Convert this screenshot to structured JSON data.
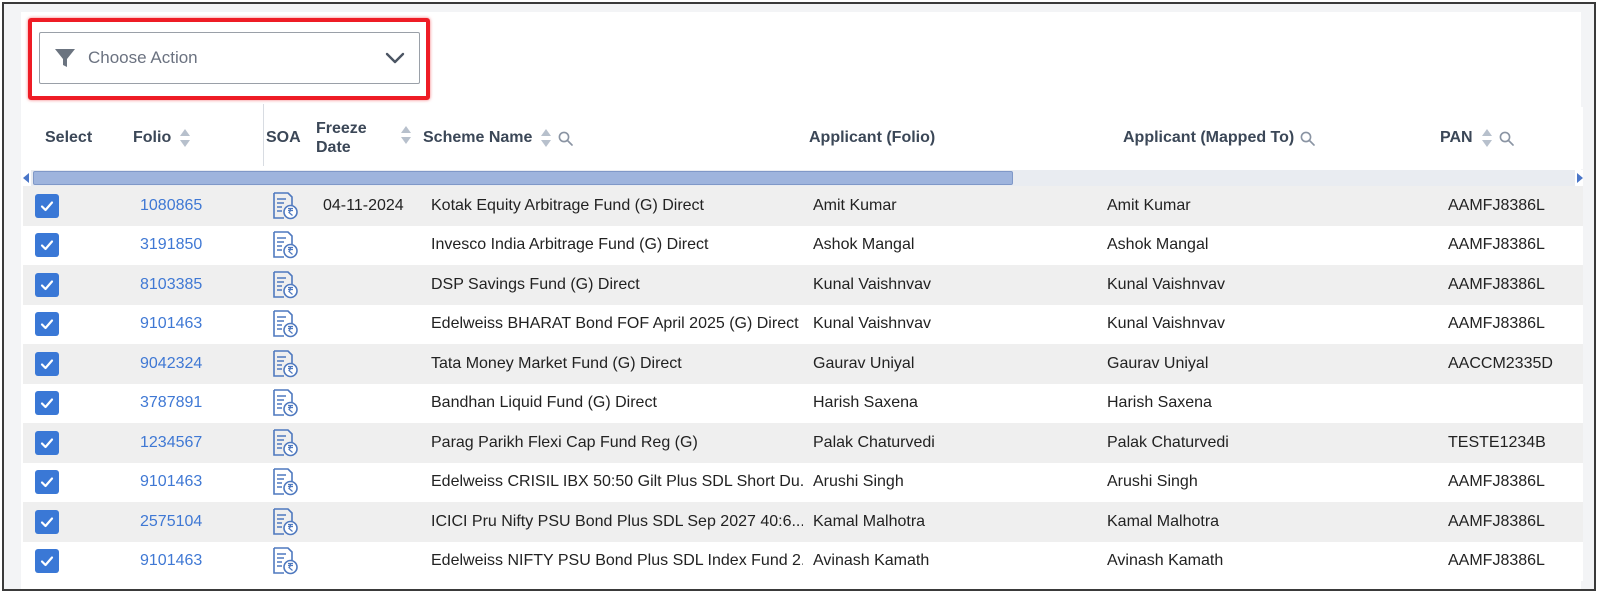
{
  "action_select": {
    "label": "Choose Action",
    "icon": "filter-icon"
  },
  "columns": {
    "select": "Select",
    "folio": "Folio",
    "soa": "SOA",
    "freeze_line1": "Freeze",
    "freeze_line2": "Date",
    "scheme": "Scheme Name",
    "applicant_folio": "Applicant (Folio)",
    "applicant_mapped": "Applicant (Mapped To)",
    "pan": "PAN"
  },
  "colors": {
    "link": "#3f78d4",
    "checkbox": "#3a78d6",
    "highlight": "#ee1c25"
  },
  "rows": [
    {
      "checked": true,
      "folio": "1080865",
      "freeze_date": "04-11-2024",
      "scheme": "Kotak Equity Arbitrage Fund (G) Direct",
      "applicant_folio": "Amit Kumar",
      "applicant_mapped": "Amit Kumar",
      "pan": "AAMFJ8386L"
    },
    {
      "checked": true,
      "folio": "3191850",
      "freeze_date": "",
      "scheme": "Invesco India Arbitrage Fund (G) Direct",
      "applicant_folio": "Ashok Mangal",
      "applicant_mapped": "Ashok Mangal",
      "pan": "AAMFJ8386L"
    },
    {
      "checked": true,
      "folio": "8103385",
      "freeze_date": "",
      "scheme": "DSP Savings Fund (G) Direct",
      "applicant_folio": "Kunal Vaishnvav",
      "applicant_mapped": "Kunal Vaishnvav",
      "pan": "AAMFJ8386L"
    },
    {
      "checked": true,
      "folio": "9101463",
      "freeze_date": "",
      "scheme": "Edelweiss BHARAT Bond FOF April 2025 (G) Direct",
      "applicant_folio": "Kunal Vaishnvav",
      "applicant_mapped": "Kunal Vaishnvav",
      "pan": "AAMFJ8386L"
    },
    {
      "checked": true,
      "folio": "9042324",
      "freeze_date": "",
      "scheme": "Tata Money Market Fund (G) Direct",
      "applicant_folio": "Gaurav Uniyal",
      "applicant_mapped": "Gaurav Uniyal",
      "pan": "AACCM2335D"
    },
    {
      "checked": true,
      "folio": "3787891",
      "freeze_date": "",
      "scheme": "Bandhan Liquid Fund (G) Direct",
      "applicant_folio": "Harish Saxena",
      "applicant_mapped": "Harish Saxena",
      "pan": ""
    },
    {
      "checked": true,
      "folio": "1234567",
      "freeze_date": "",
      "scheme": "Parag Parikh Flexi Cap Fund Reg (G)",
      "applicant_folio": "Palak Chaturvedi",
      "applicant_mapped": "Palak Chaturvedi",
      "pan": "TESTE1234B"
    },
    {
      "checked": true,
      "folio": "9101463",
      "freeze_date": "",
      "scheme": "Edelweiss CRISIL IBX 50:50 Gilt Plus SDL Short Du...",
      "applicant_folio": "Arushi Singh",
      "applicant_mapped": "Arushi Singh",
      "pan": "AAMFJ8386L"
    },
    {
      "checked": true,
      "folio": "2575104",
      "freeze_date": "",
      "scheme": "ICICI Pru Nifty PSU Bond Plus SDL Sep 2027 40:6...",
      "applicant_folio": "Kamal Malhotra",
      "applicant_mapped": "Kamal Malhotra",
      "pan": "AAMFJ8386L"
    },
    {
      "checked": true,
      "folio": "9101463",
      "freeze_date": "",
      "scheme": "Edelweiss NIFTY PSU Bond Plus SDL Index Fund 2...",
      "applicant_folio": "Avinash Kamath",
      "applicant_mapped": "Avinash Kamath",
      "pan": "AAMFJ8386L"
    }
  ]
}
